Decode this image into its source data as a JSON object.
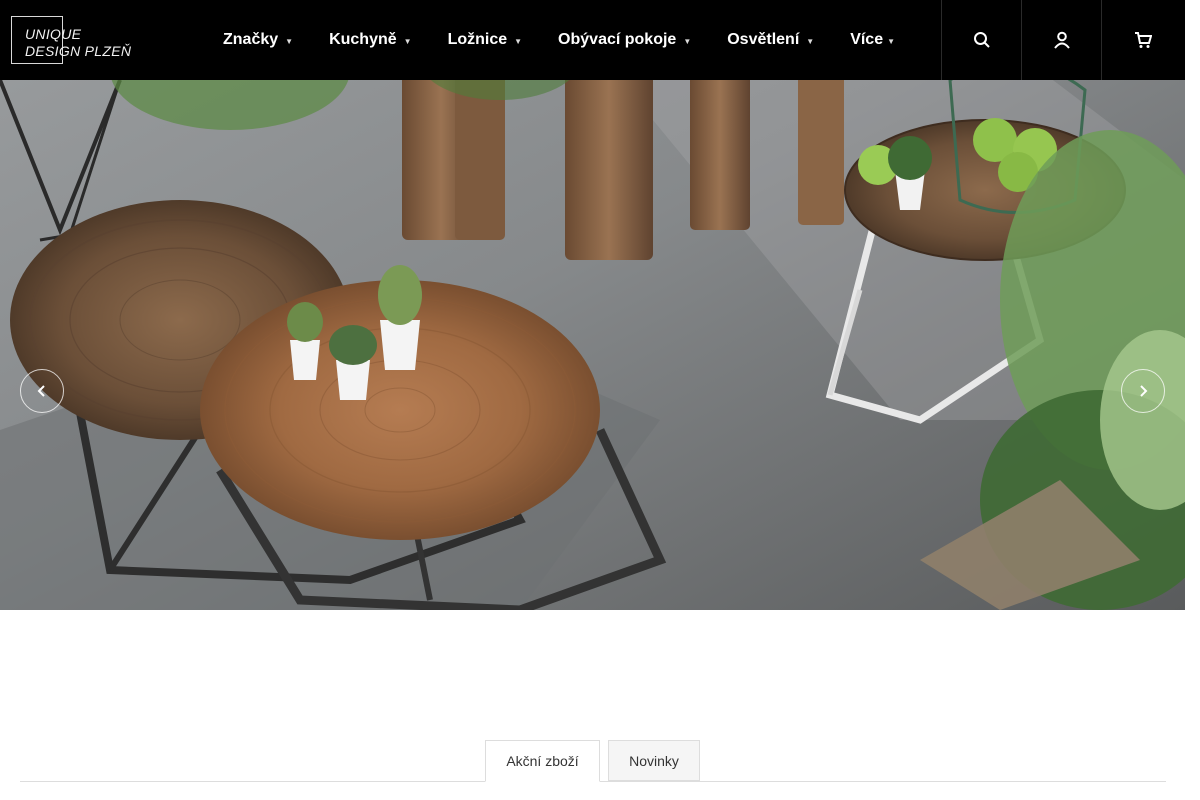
{
  "brand": {
    "logo_line1": "UNIQUE",
    "logo_line2": "DESIGN PLZEŇ"
  },
  "nav": {
    "items": [
      {
        "label": "Značky"
      },
      {
        "label": "Kuchyně"
      },
      {
        "label": "Ložnice"
      },
      {
        "label": "Obývací pokoje"
      },
      {
        "label": "Osvětlení"
      },
      {
        "label": "Více"
      }
    ],
    "icons": [
      "search-icon",
      "user-icon",
      "cart-icon"
    ]
  },
  "hero": {
    "image": "coffee tables with potted cacti on concrete floor",
    "prev_icon": "chevron-left-icon",
    "next_icon": "chevron-right-icon"
  },
  "tabs": {
    "items": [
      {
        "label": "Akční zboží",
        "active": true
      },
      {
        "label": "Novinky",
        "active": false
      }
    ]
  },
  "colors": {
    "header_bg": "#000000",
    "text_light": "#ffffff",
    "tab_border": "#dddddd"
  }
}
